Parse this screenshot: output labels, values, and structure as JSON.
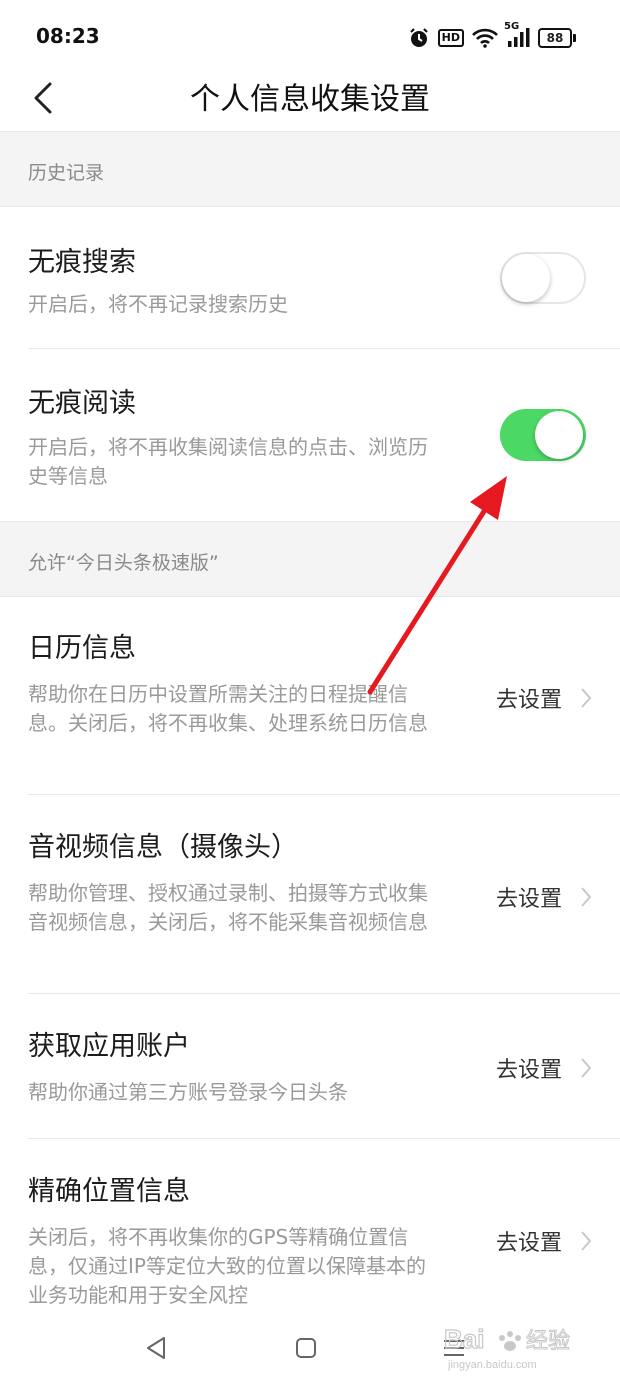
{
  "status": {
    "time": "08:23",
    "hd": "HD",
    "network": "5G",
    "battery": "88"
  },
  "header": {
    "title": "个人信息收集设置"
  },
  "history_section": {
    "label": "历史记录"
  },
  "incognito_search": {
    "title": "无痕搜索",
    "desc": "开启后，将不再记录搜索历史",
    "enabled": false
  },
  "incognito_read": {
    "title": "无痕阅读",
    "desc": "开启后，将不再收集阅读信息的点击、浏览历史等信息",
    "enabled": true
  },
  "allow_section": {
    "label": "允许“今日头条极速版”"
  },
  "permissions": [
    {
      "title": "日历信息",
      "desc": "帮助你在日历中设置所需关注的日程提醒信息。关闭后，将不再收集、处理系统日历信息",
      "action": "去设置"
    },
    {
      "title": "音视频信息（摄像头）",
      "desc": "帮助你管理、授权通过录制、拍摄等方式收集音视频信息，关闭后，将不能采集音视频信息",
      "action": "去设置"
    },
    {
      "title": "获取应用账户",
      "desc": "帮助你通过第三方账号登录今日头条",
      "action": "去设置"
    },
    {
      "title": "精确位置信息",
      "desc": "关闭后，将不再收集你的GPS等精确位置信息，仅通过IP等定位大致的位置以保障基本的业务功能和用于安全风控",
      "action": "去设置"
    }
  ],
  "colors": {
    "toggle_on": "#4cd864",
    "arrow": "#e5191f",
    "section_bg": "#f4f4f4"
  },
  "watermark": {
    "brand": "Bai",
    "brand2": "经验",
    "url": "jingyan.baidu.com"
  }
}
